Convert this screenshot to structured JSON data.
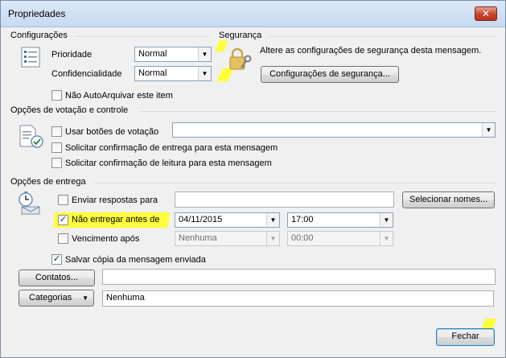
{
  "window": {
    "title": "Propriedades",
    "close_glyph": "✕"
  },
  "settings": {
    "section_title": "Configurações",
    "priority_label": "Prioridade",
    "priority_value": "Normal",
    "sensitivity_label": "Confidencialidade",
    "sensitivity_value": "Normal",
    "no_autoarchive_label": "Não AutoArquivar este item"
  },
  "security": {
    "section_title": "Segurança",
    "description": "Altere as configurações de segurança desta mensagem.",
    "button_label": "Configurações de segurança..."
  },
  "voting": {
    "section_title": "Opções de votação e controle",
    "use_voting_label": "Usar botões de votação",
    "voting_value": "",
    "delivery_receipt_label": "Solicitar confirmação de entrega para esta mensagem",
    "read_receipt_label": "Solicitar confirmação de leitura para esta mensagem"
  },
  "delivery": {
    "section_title": "Opções de entrega",
    "reply_to_label": "Enviar respostas para",
    "reply_to_value": "",
    "select_names_button": "Selecionar nomes...",
    "do_not_deliver_label": "Não entregar antes de",
    "do_not_deliver_checked": true,
    "deliver_date": "04/11/2015",
    "deliver_time": "17:00",
    "expires_label": "Vencimento após",
    "expires_date": "Nenhuma",
    "expires_time": "00:00",
    "save_copy_label": "Salvar cópia da mensagem enviada",
    "save_copy_checked": true
  },
  "contacts": {
    "button_label": "Contatos...",
    "value": ""
  },
  "categories": {
    "button_label": "Categorias",
    "value": "Nenhuma"
  },
  "footer": {
    "close_button": "Fechar"
  },
  "colors": {
    "highlight": "#ffff3c",
    "title_bar": "#c7daf0",
    "accent": "#3c7fb1"
  }
}
